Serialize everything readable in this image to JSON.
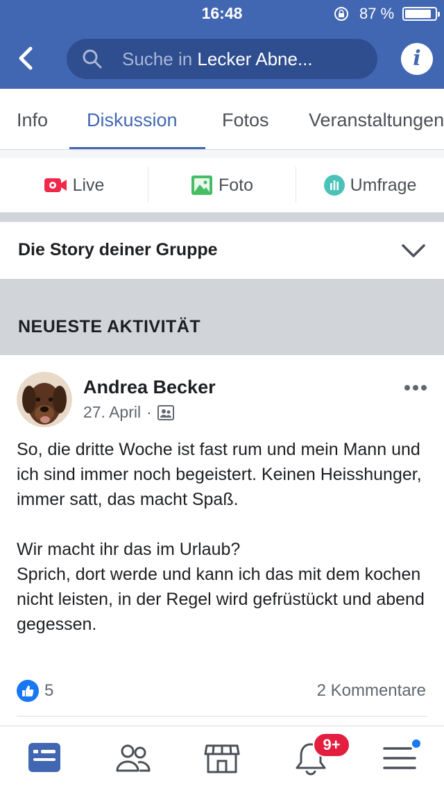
{
  "status_bar": {
    "time": "16:48",
    "battery_percent": "87 %",
    "battery_level": 0.87
  },
  "header": {
    "search_placeholder": "Suche in ",
    "search_group": "Lecker Abne...",
    "back_icon": "chevron-left-icon",
    "info_icon": "info-icon",
    "bar_color": "#4267b2"
  },
  "tabs": [
    {
      "label": "Info",
      "active": false
    },
    {
      "label": "Diskussion",
      "active": true
    },
    {
      "label": "Fotos",
      "active": false
    },
    {
      "label": "Veranstaltungen",
      "active": false
    }
  ],
  "composer": {
    "live": "Live",
    "photo": "Foto",
    "poll": "Umfrage"
  },
  "story": {
    "title": "Die Story deiner Gruppe"
  },
  "section": {
    "title": "NEUESTE AKTIVITÄT"
  },
  "post": {
    "author": "Andrea Becker",
    "date": "27. April",
    "meta_separator": "·",
    "paragraph1": "So, die dritte Woche ist fast rum und mein Mann und ich sind immer noch begeistert. Keinen Heisshunger, immer satt, das macht Spaß.",
    "paragraph2_line1": "Wir macht ihr das im Urlaub?",
    "paragraph2_line2": "Sprich, dort werde und kann ich das mit dem kochen nicht leisten, in der Regel wird gefrüstückt und abend gegessen.",
    "like_count": "5",
    "comments": "2 Kommentare"
  },
  "bottom_nav": {
    "notification_badge": "9+",
    "items": [
      "news-feed-icon",
      "groups-icon",
      "marketplace-icon",
      "notifications-icon",
      "menu-icon"
    ]
  }
}
